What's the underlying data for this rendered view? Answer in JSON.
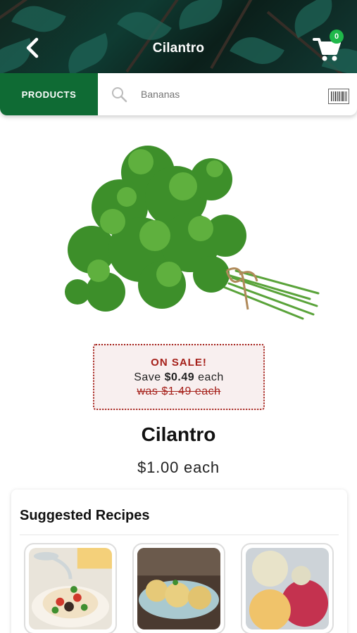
{
  "header": {
    "title": "Cilantro",
    "back_icon": "chevron-left-icon",
    "cart_icon": "cart-icon",
    "cart_count": "0",
    "badge_color": "#1fb84a"
  },
  "search": {
    "products_label": "PRODUCTS",
    "placeholder": "Bananas",
    "search_icon": "search-icon",
    "barcode_icon": "barcode-icon",
    "brand_color": "#0f6b34"
  },
  "product": {
    "name": "Cilantro",
    "price": "$1.00 each",
    "sale": {
      "title": "ON SALE!",
      "save_prefix": "Save",
      "save_amount": "$0.49",
      "save_suffix": "each",
      "was": "was $1.49 each",
      "color": "#a5201a"
    }
  },
  "recipes": {
    "title": "Suggested Recipes",
    "items": [
      {
        "name": "taco-recipe"
      },
      {
        "name": "croquette-recipe"
      },
      {
        "name": "ice-cream-recipe"
      }
    ]
  }
}
